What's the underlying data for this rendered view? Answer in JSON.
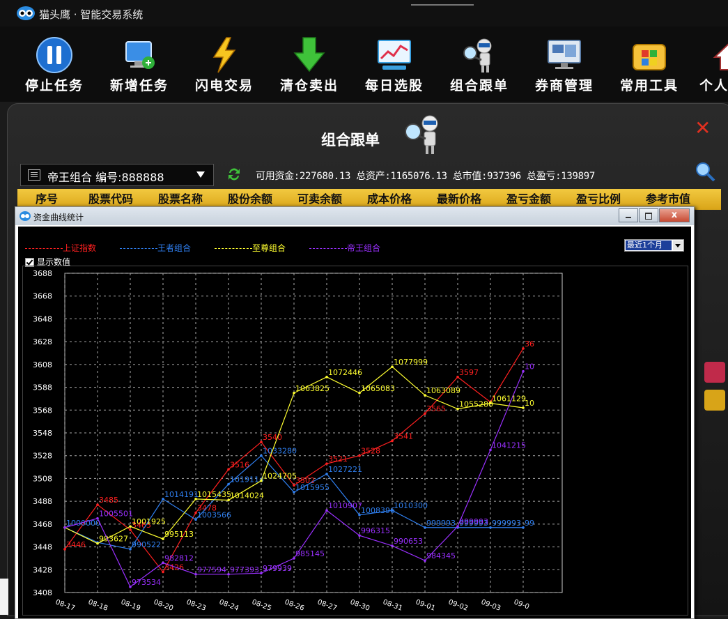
{
  "app": {
    "title": "猫头鹰 · 智能交易系统"
  },
  "toolbar": {
    "items": [
      {
        "label": "停止任务",
        "icon": "pause-icon"
      },
      {
        "label": "新增任务",
        "icon": "add-task-icon"
      },
      {
        "label": "闪电交易",
        "icon": "lightning-icon"
      },
      {
        "label": "清仓卖出",
        "icon": "down-arrow-icon"
      },
      {
        "label": "每日选股",
        "icon": "stock-chart-icon"
      },
      {
        "label": "组合跟单",
        "icon": "magnifier-robot-icon"
      },
      {
        "label": "券商管理",
        "icon": "monitor-icon"
      },
      {
        "label": "常用工具",
        "icon": "toolbox-icon"
      },
      {
        "label": "个人",
        "icon": "home-icon"
      }
    ]
  },
  "panel": {
    "title": "组合跟单",
    "combo_value": "帝王组合  编号:888888",
    "stats": "可用资金:227680.13 总资产:1165076.13 总市值:937396 总盈亏:139897",
    "columns": [
      "序号",
      "股票代码",
      "股票名称",
      "股份余额",
      "可卖余额",
      "成本价格",
      "最新价格",
      "盈亏金额",
      "盈亏比例",
      "参考市值"
    ]
  },
  "window": {
    "title": "资金曲线统计",
    "close_glyph": "x",
    "range_value": "最近1个月",
    "show_values_label": "显示数值"
  },
  "colors": {
    "shanghai": "#ff2020",
    "wangzhe": "#2f7ff0",
    "zhizun": "#ffff30",
    "diwang": "#9a30ff",
    "grid": "#aaaaaa"
  },
  "chart_data": {
    "type": "line",
    "x": [
      "08-17",
      "08-18",
      "08-19",
      "08-20",
      "08-23",
      "08-24",
      "08-25",
      "08-26",
      "08-27",
      "08-30",
      "08-31",
      "09-01",
      "09-02",
      "09-03",
      "09-0"
    ],
    "ylim": [
      3408,
      3688
    ],
    "yticks": [
      3408,
      3428,
      3448,
      3468,
      3488,
      3508,
      3528,
      3548,
      3568,
      3588,
      3608,
      3628,
      3648,
      3668,
      3688
    ],
    "grid": true,
    "legend": "top",
    "series": [
      {
        "name": "上证指数",
        "color": "#ff2020",
        "y": [
          3446,
          3485,
          3463,
          3426,
          3478,
          3516,
          3540,
          3502,
          3521,
          3528,
          3541,
          3565,
          3597,
          3575,
          3622
        ],
        "labels": [
          "3446",
          "3485",
          "3465",
          "3426",
          "3478",
          "3516",
          "3540",
          "3502",
          "3521",
          "3528",
          "3541",
          "3565",
          "3597",
          "",
          "36"
        ]
      },
      {
        "name": "王者组合",
        "color": "#2f7ff0",
        "y": [
          3465,
          3452,
          3446,
          3490,
          3472,
          3503,
          3528,
          3496,
          3512,
          3476,
          3480,
          3465,
          3465,
          3465,
          3465
        ],
        "labels": [
          "1000000",
          "",
          "990522",
          "1014191",
          "1003566",
          "1019114",
          "1033280",
          "1015955",
          "1027221",
          "1008396",
          "1010300",
          "999993",
          "999993",
          "999993",
          "99"
        ]
      },
      {
        "name": "至尊组合",
        "color": "#ffff30",
        "y": [
          3465,
          3451,
          3466,
          3455,
          3490,
          3489,
          3506,
          3583,
          3597,
          3583,
          3606,
          3581,
          3569,
          3574,
          3570
        ],
        "labels": [
          "",
          "993627",
          "1001925",
          "995113",
          "1015435",
          "1014024",
          "1024705",
          "1063825",
          "1072446",
          "1065083",
          "1077999",
          "1063089",
          "1055280",
          "1061129",
          "10"
        ]
      },
      {
        "name": "帝王组合",
        "color": "#9a30ff",
        "y": [
          3465,
          3473,
          3413,
          3434,
          3424,
          3424,
          3425,
          3438,
          3480,
          3458,
          3449,
          3436,
          3466,
          3533,
          3602
        ],
        "labels": [
          "",
          "1005501",
          "973534",
          "982812",
          "977594",
          "977393",
          "979939",
          "985145",
          "1010907",
          "996315",
          "990653",
          "984345",
          "999993",
          "1041215",
          "10"
        ]
      }
    ]
  }
}
